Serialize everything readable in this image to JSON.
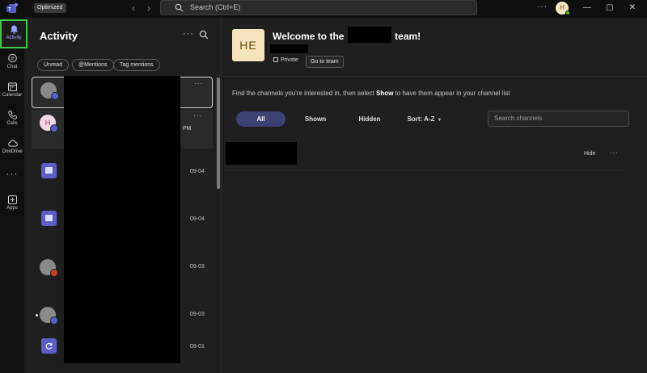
{
  "titlebar": {
    "badge": "Optimized",
    "search_placeholder": "Search (Ctrl+E)",
    "more": "···",
    "avatar_initial": "H",
    "window_buttons": {
      "minimize": "—",
      "maximize": "▢",
      "close": "✕"
    }
  },
  "rail": {
    "items": [
      {
        "label": "Activity",
        "icon": "bell-icon"
      },
      {
        "label": "Chat",
        "icon": "chat-icon"
      },
      {
        "label": "Calendar",
        "icon": "calendar-icon"
      },
      {
        "label": "Calls",
        "icon": "phone-icon"
      },
      {
        "label": "OneDrive",
        "icon": "cloud-icon"
      },
      {
        "label": "Apps",
        "icon": "plus-square-icon"
      }
    ],
    "more": "···"
  },
  "activity": {
    "title": "Activity",
    "more": "···",
    "filters": [
      "Unread",
      "@Mentions",
      "Tag mentions"
    ],
    "items": [
      {
        "avatar_initial": "",
        "date": "",
        "more": "···"
      },
      {
        "avatar_initial": "H",
        "date": "",
        "time_suffix": "PM",
        "more": "···"
      },
      {
        "date": "09-04"
      },
      {
        "date": "09-04"
      },
      {
        "date": "09-03"
      },
      {
        "date": "09-03"
      },
      {
        "date": "09-01"
      }
    ]
  },
  "main": {
    "team_initials": "HE",
    "welcome_prefix": "Welcome to the",
    "welcome_suffix": "team!",
    "privacy": "Private",
    "goto_button": "Go to team",
    "info_prefix": "Find the channels you're interested in, then select ",
    "info_bold": "Show",
    "info_suffix": " to have them appear in your channel list",
    "tabs": [
      "All",
      "Shown",
      "Hidden"
    ],
    "sort": "Sort: A-Z",
    "search_placeholder": "Search channels",
    "row_hide": "Hide",
    "row_more": "···"
  },
  "colors": {
    "accent": "#5b5fc7",
    "rail_active_outline": "#3ec94b",
    "active_pill": "#3d4274",
    "background": "#1f1f1f"
  }
}
